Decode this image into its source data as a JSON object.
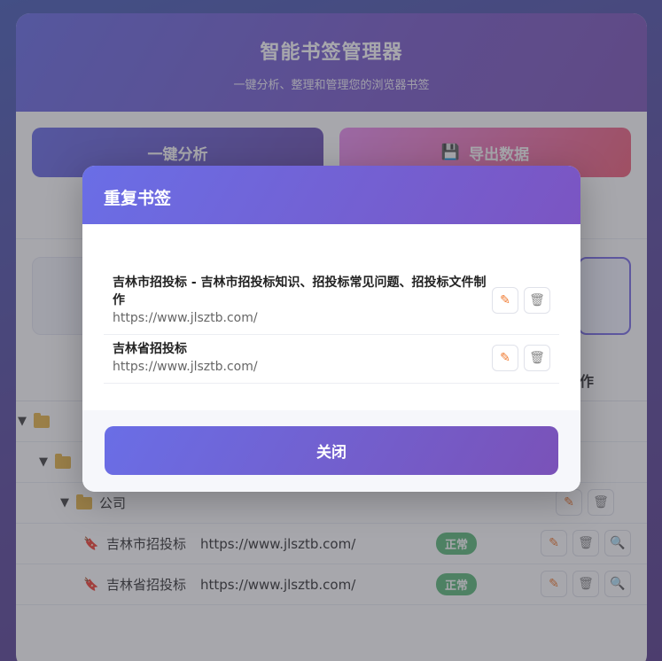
{
  "app": {
    "title": "智能书签管理器",
    "subtitle": "一键分析、整理和管理您的浏览器书签",
    "analyze_label": "一键分析",
    "export_label": "导出数据",
    "export_icon": "floppy-disk-icon",
    "ops_header": "操作"
  },
  "tree": [
    {
      "type": "folder",
      "label": ""
    },
    {
      "type": "folder",
      "label": ""
    },
    {
      "type": "folder",
      "label": "公司"
    }
  ],
  "bookmarks": [
    {
      "title": "吉林市招投标",
      "url": "https://www.jlsztb.com/",
      "status": "正常"
    },
    {
      "title": "吉林省招投标",
      "url": "https://www.jlsztb.com/",
      "status": "正常"
    }
  ],
  "modal": {
    "title": "重复书签",
    "items": [
      {
        "title": "吉林市招投标 - 吉林市招投标知识、招投标常见问题、招投标文件制作",
        "url": "https://www.jlsztb.com/"
      },
      {
        "title": "吉林省招投标",
        "url": "https://www.jlsztb.com/"
      }
    ],
    "close_label": "关闭"
  },
  "icons": {
    "edit": "✎",
    "delete": "🗑",
    "search": "🔍",
    "bookmark": "🔖",
    "save": "💾"
  },
  "colors": {
    "accent": "#6a6ee6",
    "status_ok": "#5dbb7a"
  }
}
